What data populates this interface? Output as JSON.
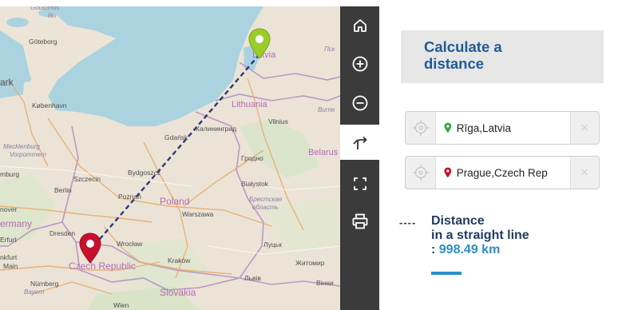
{
  "map": {
    "labels": {
      "gotalands": "Götalands",
      "lan": "län",
      "goteborg": "Göteborg",
      "ark": "ark",
      "kobenhavn": "København",
      "latvia": "Latvia",
      "lithuania": "Lithuania",
      "vilnius": "Vilnius",
      "gdansk": "Gdańsk",
      "kaliningrad": "Калининград",
      "grodno": "Гродно",
      "belarus": "Belarus",
      "mecklenburg": "Mecklenburg",
      "vorpommern": "Vorpommern",
      "hamburg": "mburg",
      "szczecin": "Szczecin",
      "bydgoszcz": "Bydgoszcz",
      "berlin": "Berlin",
      "poznan": "Poznań",
      "poland": "Poland",
      "bialystok": "Białystok",
      "brest_obl_1": "Брестская",
      "brest_obl_2": "область",
      "warszawa": "Warszawa",
      "hanover": "nover",
      "germany": "ermany",
      "dresden": "Dresden",
      "erfurt": "Erfurt",
      "wroclaw": "Wrocław",
      "lutsk": "Луцьк",
      "frankfurt_1": "nkfurt",
      "frankfurt_2": "Main",
      "czech_republic": "Czech Republic",
      "krakow": "Kraków",
      "zhytomyr": "Житомир",
      "nurnberg": "Nürnberg",
      "bayern": "Bayern",
      "lviv": "Львів",
      "vinnytsia": "Вінни",
      "slovakia": "Slovakia",
      "wien": "Wien",
      "pskov": "Пск",
      "bumen": "Burne"
    }
  },
  "toolbar": {
    "buttons": [
      {
        "name": "home",
        "icon": "home-icon"
      },
      {
        "name": "zoom-in",
        "icon": "zoom-in-icon"
      },
      {
        "name": "zoom-out",
        "icon": "zoom-out-icon"
      },
      {
        "name": "route",
        "icon": "route-turn-icon",
        "active": true
      },
      {
        "name": "fullscreen",
        "icon": "fullscreen-icon"
      },
      {
        "name": "print",
        "icon": "print-icon"
      }
    ]
  },
  "panel": {
    "title": "Calculate a distance",
    "from": {
      "value": "Rīga,Latvia",
      "pin_color": "#2fa84f",
      "clear_label": "×"
    },
    "to": {
      "value": "Prague,Czech Rep",
      "pin_color": "#c8102e",
      "clear_label": "×"
    },
    "result": {
      "dash": "----",
      "line1": "Distance",
      "line2": "in a straight line",
      "prefix": ": ",
      "value": "998.49 km"
    }
  },
  "colors": {
    "accent_blue": "#2a8fc9",
    "title_blue": "#1f5b97",
    "toolbar_bg": "#3b3b3b",
    "start_pin": "#9ccc2a",
    "end_pin": "#c8102e",
    "route_line": "#2b3a7a"
  }
}
